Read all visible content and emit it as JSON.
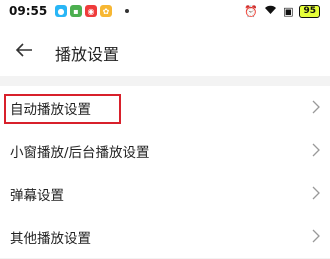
{
  "status_bar": {
    "time": "09:55",
    "battery": "95",
    "app_icons": [
      {
        "name": "app-icon-1",
        "color": "#29b6f6"
      },
      {
        "name": "app-icon-2",
        "color": "#4caf50"
      },
      {
        "name": "app-icon-3",
        "color": "#ef3b3b"
      },
      {
        "name": "app-icon-4",
        "color": "#f7b733"
      }
    ],
    "right_icons": [
      "alarm-icon",
      "wifi-icon",
      "sim-icon",
      "battery-icon"
    ]
  },
  "header": {
    "title": "播放设置",
    "back_icon": "arrow-left-icon"
  },
  "settings": {
    "items": [
      {
        "label": "自动播放设置",
        "highlighted": true
      },
      {
        "label": "小窗播放/后台播放设置"
      },
      {
        "label": "弹幕设置"
      },
      {
        "label": "其他播放设置"
      }
    ]
  },
  "colors": {
    "highlight": "#d8202b",
    "background": "#f3f3f3"
  }
}
